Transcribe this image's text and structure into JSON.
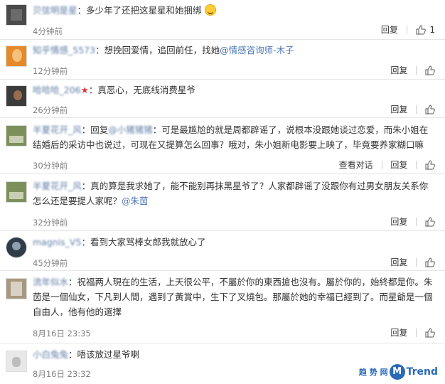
{
  "comments": [
    {
      "username": "贝弦明是星",
      "avatar_colors": [
        "#4a4a4a",
        "#6b6b6b"
      ],
      "text": "：多少年了还把这星星和她捆绑",
      "has_emoji": true,
      "time": "4分钟前",
      "reply_label": "回复",
      "like_count": "1"
    },
    {
      "username": "知乎情感_5573",
      "avatar_colors": [
        "#e58a2a",
        "#f4c07a"
      ],
      "text": "：想挽回爱情，追回前任，找她",
      "link": "@情感咨询师-木子",
      "time": "12分钟前",
      "reply_label": "回复"
    },
    {
      "username": "哈哈哈_206",
      "has_star": true,
      "star": "★",
      "avatar_colors": [
        "#3b3b3b",
        "#9a6b4f"
      ],
      "text": "：真恶心，无底线消费星爷",
      "time": "26分钟前",
      "reply_label": "回复"
    },
    {
      "username": "半夏花开_风",
      "avatar_colors": [
        "#7d8f5a",
        "#c9cfb2"
      ],
      "reply_prefix": "：回复",
      "reply_to": "@小猪猪猪",
      "text": "：可是最尴尬的就是周都辟谣了，说根本没跟她谈过恋爱，而朱小姐在结婚后的采访中也说过，可现在又提算怎么回事？哦对，朱小姐新电影要上映了，毕竟要养家糊口嘛",
      "time": "30分钟前",
      "view_dialog": "查看对话",
      "reply_label": "回复"
    },
    {
      "username": "半夏花开_风",
      "avatar_colors": [
        "#7d8f5a",
        "#c9cfb2"
      ],
      "text": "：真的算是我求她了，能不能别再抹黑星爷了？人家都辟谣了没跟你有过男女朋友关系你怎么还是要提人家呢？",
      "link": "@朱茵",
      "time": "32分钟前",
      "reply_label": "回复"
    },
    {
      "username": "magnis_V5",
      "avatar_colors": [
        "#2f3c4a",
        "#8ea0b0"
      ],
      "text": "：看到大家骂棒女郎我就放心了",
      "time": "45分钟前",
      "reply_label": "回复"
    },
    {
      "username": "流年似水",
      "avatar_colors": [
        "#a89880",
        "#d9d2c4"
      ],
      "text": "：祝福两人現在的生活，上天很公平，不屬於你的東西搶也沒有。屬於你的，始終都是你。朱茵是一個仙女，下凡到人間，遇到了黃賞中，生下了叉燒包。那屬於她的幸福已經到了。而星爺是一個自由人，他有他的選擇",
      "time": "8月16日 23:35",
      "reply_label": "回复"
    },
    {
      "username": "小白兔兔",
      "avatar_colors": [
        "#e8e8e8",
        "#bdbdbd"
      ],
      "text": "：唔该放过星爷喇",
      "time": "8月16日 23:32",
      "reply_label": "回复"
    }
  ],
  "watermark": {
    "prefix": "趋 势 网",
    "logo": "M",
    "suffix": "Trend"
  }
}
